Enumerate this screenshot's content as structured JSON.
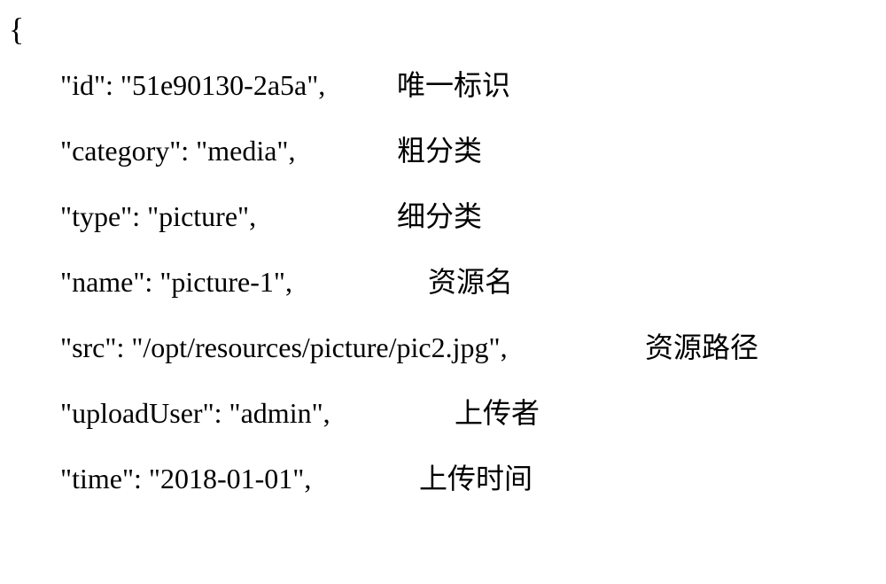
{
  "brace": "{",
  "lines": [
    {
      "json": "\"id\": \"51e90130-2a5a\",",
      "comment": "唯一标识",
      "widthClass": "w1"
    },
    {
      "json": "\"category\": \"media\",",
      "comment": "粗分类",
      "widthClass": "w2"
    },
    {
      "json": "\"type\": \"picture\",",
      "comment": "细分类",
      "widthClass": "w3"
    },
    {
      "json": "\"name\": \"picture-1\",",
      "comment": "资源名",
      "widthClass": "w4"
    },
    {
      "json": "\"src\": \"/opt/resources/picture/pic2.jpg\",",
      "comment": "资源路径",
      "widthClass": "w5"
    },
    {
      "json": "\"uploadUser\": \"admin\",",
      "comment": "上传者",
      "widthClass": "w6"
    },
    {
      "json": "\"time\": \"2018-01-01\",",
      "comment": "上传时间",
      "widthClass": "w7"
    }
  ]
}
